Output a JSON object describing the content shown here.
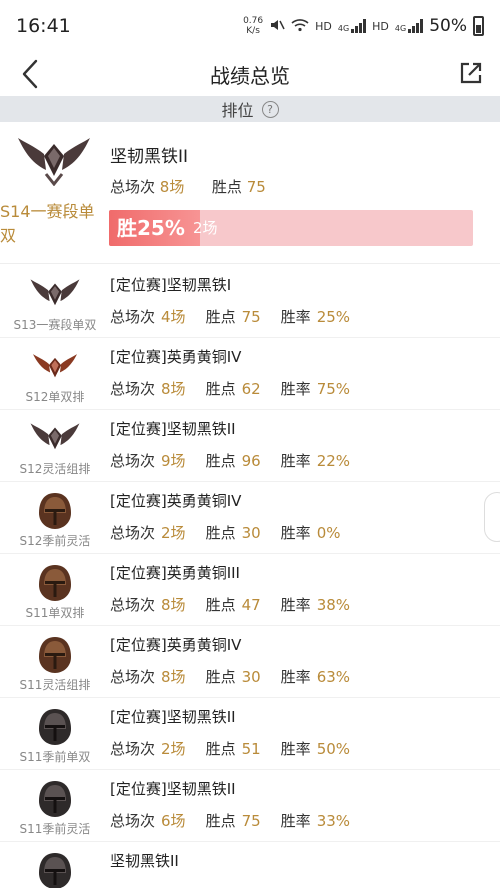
{
  "status": {
    "time": "16:41",
    "net_speed_value": "0.76",
    "net_speed_unit": "K/s",
    "hd1": "HD",
    "net1": "4G",
    "hd2": "HD",
    "net2": "4G",
    "battery": "50%"
  },
  "header": {
    "title": "战绩总览",
    "back_icon": "chevron-left-icon",
    "share_icon": "share-external-icon"
  },
  "section": {
    "label": "排位",
    "help_icon": "help-circle-icon"
  },
  "featured": {
    "rank": "坚韧黑铁II",
    "season": "S14一赛段单双",
    "total_label": "总场次",
    "total": "8场",
    "points_label": "胜点",
    "points": "75",
    "win_text": "胜25%",
    "win_ratio": 0.25,
    "win_count": "2场"
  },
  "labels": {
    "total": "总场次",
    "points": "胜点",
    "rate": "胜率"
  },
  "seasons": [
    {
      "season": "S13一赛段单双",
      "rank": "[定位赛]坚韧黑铁I",
      "total": "4场",
      "points": "75",
      "rate": "25%",
      "emblem": "iron"
    },
    {
      "season": "S12单双排",
      "rank": "[定位赛]英勇黄铜IV",
      "total": "8场",
      "points": "62",
      "rate": "75%",
      "emblem": "bronze-wings"
    },
    {
      "season": "S12灵活组排",
      "rank": "[定位赛]坚韧黑铁II",
      "total": "9场",
      "points": "96",
      "rate": "22%",
      "emblem": "iron"
    },
    {
      "season": "S12季前灵活",
      "rank": "[定位赛]英勇黄铜IV",
      "total": "2场",
      "points": "30",
      "rate": "0%",
      "emblem": "bronze-helm"
    },
    {
      "season": "S11单双排",
      "rank": "[定位赛]英勇黄铜III",
      "total": "8场",
      "points": "47",
      "rate": "38%",
      "emblem": "bronze-helm"
    },
    {
      "season": "S11灵活组排",
      "rank": "[定位赛]英勇黄铜IV",
      "total": "8场",
      "points": "30",
      "rate": "63%",
      "emblem": "bronze-helm"
    },
    {
      "season": "S11季前单双",
      "rank": "[定位赛]坚韧黑铁II",
      "total": "2场",
      "points": "51",
      "rate": "50%",
      "emblem": "iron-helm"
    },
    {
      "season": "S11季前灵活",
      "rank": "[定位赛]坚韧黑铁II",
      "total": "6场",
      "points": "75",
      "rate": "33%",
      "emblem": "iron-helm"
    },
    {
      "season": "",
      "rank": "坚韧黑铁II",
      "total": "",
      "points": "",
      "rate": "",
      "emblem": "iron-helm"
    }
  ],
  "colors": {
    "accent_gold": "#b98b3a",
    "win_bar": "#f06b6b",
    "win_bar_bg": "#f7c8cb"
  }
}
